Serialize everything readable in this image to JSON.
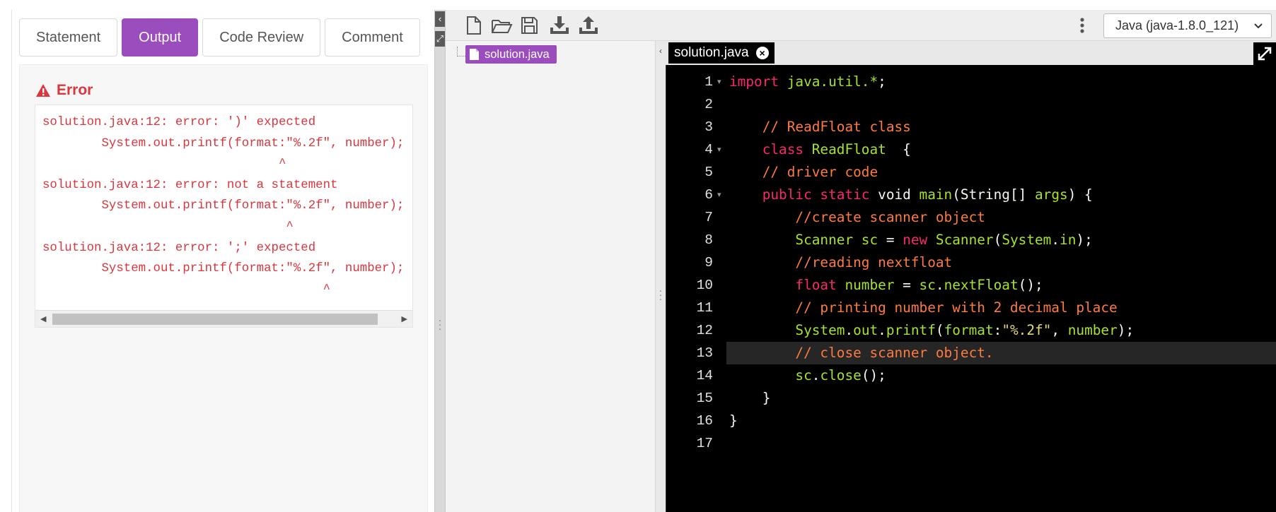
{
  "left_tabs": [
    {
      "label": "Statement",
      "active": false
    },
    {
      "label": "Output",
      "active": true
    },
    {
      "label": "Code Review",
      "active": false
    },
    {
      "label": "Comment",
      "active": false
    }
  ],
  "output": {
    "heading": "Error",
    "log_lines": [
      "solution.java:12: error: ')' expected",
      "        System.out.printf(format:\"%.2f\", number);",
      "                                ^",
      "solution.java:12: error: not a statement",
      "        System.out.printf(format:\"%.2f\", number);",
      "                                 ^",
      "solution.java:12: error: ';' expected",
      "        System.out.printf(format:\"%.2f\", number);",
      "                                      ^"
    ]
  },
  "toolbar": {
    "icons": [
      "new-file-icon",
      "open-folder-icon",
      "save-icon",
      "download-icon",
      "upload-icon"
    ],
    "language": "Java (java-1.8.0_121)"
  },
  "file_tree": {
    "files": [
      "solution.java"
    ]
  },
  "editor": {
    "tab_label": "solution.java",
    "current_line": 13,
    "fold_lines": [
      1,
      4,
      6
    ],
    "lines": [
      [
        [
          "kw",
          "import "
        ],
        [
          "id",
          "java.util.*"
        ],
        [
          "pl",
          ";"
        ]
      ],
      [],
      [
        [
          "pl",
          "    "
        ],
        [
          "cm",
          "// ReadFloat class"
        ]
      ],
      [
        [
          "pl",
          "    "
        ],
        [
          "kw",
          "class "
        ],
        [
          "id",
          "ReadFloat"
        ],
        [
          "pl",
          "  {"
        ]
      ],
      [
        [
          "pl",
          "    "
        ],
        [
          "cm",
          "// driver code"
        ]
      ],
      [
        [
          "pl",
          "    "
        ],
        [
          "kw",
          "public static "
        ],
        [
          "pl",
          "void "
        ],
        [
          "id",
          "main"
        ],
        [
          "pl",
          "(String[] "
        ],
        [
          "id",
          "args"
        ],
        [
          "pl",
          ") {"
        ]
      ],
      [
        [
          "pl",
          "        "
        ],
        [
          "cm",
          "//create scanner object"
        ]
      ],
      [
        [
          "pl",
          "        "
        ],
        [
          "id",
          "Scanner sc"
        ],
        [
          "pl",
          " = "
        ],
        [
          "kw",
          "new "
        ],
        [
          "id",
          "Scanner"
        ],
        [
          "pl",
          "("
        ],
        [
          "id",
          "System"
        ],
        [
          "pl",
          "."
        ],
        [
          "id",
          "in"
        ],
        [
          "pl",
          ");"
        ]
      ],
      [
        [
          "pl",
          "        "
        ],
        [
          "cm",
          "//reading nextfloat"
        ]
      ],
      [
        [
          "pl",
          "        "
        ],
        [
          "kw",
          "float "
        ],
        [
          "id",
          "number"
        ],
        [
          "pl",
          " = "
        ],
        [
          "id",
          "sc"
        ],
        [
          "pl",
          "."
        ],
        [
          "id",
          "nextFloat"
        ],
        [
          "pl",
          "();"
        ]
      ],
      [
        [
          "pl",
          "        "
        ],
        [
          "cm",
          "// printing number with 2 decimal place"
        ]
      ],
      [
        [
          "pl",
          "        "
        ],
        [
          "id",
          "System"
        ],
        [
          "pl",
          "."
        ],
        [
          "id",
          "out"
        ],
        [
          "pl",
          "."
        ],
        [
          "id",
          "printf"
        ],
        [
          "pl",
          "("
        ],
        [
          "id",
          "format"
        ],
        [
          "pl",
          ":"
        ],
        [
          "st",
          "\"%.2f\""
        ],
        [
          "pl",
          ", "
        ],
        [
          "id",
          "number"
        ],
        [
          "pl",
          ");"
        ]
      ],
      [
        [
          "pl",
          "        "
        ],
        [
          "cm",
          "// close scanner object."
        ]
      ],
      [
        [
          "pl",
          "        "
        ],
        [
          "id",
          "sc"
        ],
        [
          "pl",
          "."
        ],
        [
          "id",
          "close"
        ],
        [
          "pl",
          "();"
        ]
      ],
      [
        [
          "pl",
          "    }"
        ]
      ],
      [
        [
          "pl",
          "}"
        ]
      ],
      []
    ]
  },
  "colors": {
    "accent": "#9b4dbd",
    "error": "#d9363e",
    "editor_bg": "#000000"
  }
}
